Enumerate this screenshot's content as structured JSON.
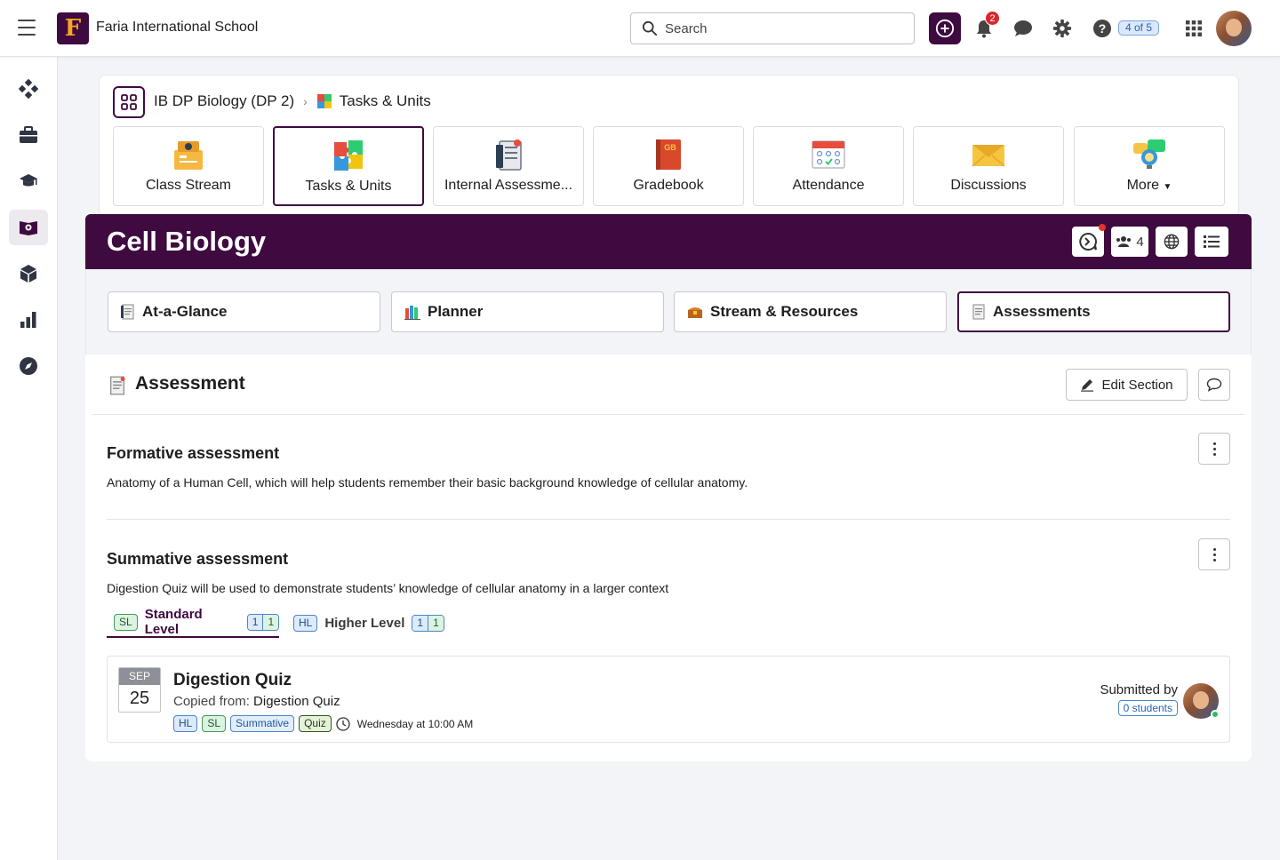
{
  "topbar": {
    "school_name": "Faria International School",
    "logo_letter": "F",
    "search_placeholder": "Search",
    "notification_count": "2",
    "help_progress": "4 of 5"
  },
  "breadcrumb": {
    "course": "IB DP Biology (DP 2)",
    "current": "Tasks & Units"
  },
  "tools": [
    {
      "label": "Class Stream",
      "icon": "class-stream-icon"
    },
    {
      "label": "Tasks & Units",
      "icon": "puzzle-icon"
    },
    {
      "label": "Internal Assessme...",
      "icon": "clipboard-icon"
    },
    {
      "label": "Gradebook",
      "icon": "gradebook-icon"
    },
    {
      "label": "Attendance",
      "icon": "calendar-icon"
    },
    {
      "label": "Discussions",
      "icon": "envelope-icon"
    },
    {
      "label": "More",
      "icon": "bulb-chat-icon"
    }
  ],
  "unit": {
    "title": "Cell Biology",
    "members_count": "4"
  },
  "section_tabs": [
    {
      "label": "At-a-Glance"
    },
    {
      "label": "Planner"
    },
    {
      "label": "Stream & Resources"
    },
    {
      "label": "Assessments"
    }
  ],
  "section": {
    "title": "Assessment",
    "edit_label": "Edit Section"
  },
  "assessments": [
    {
      "title": "Formative assessment",
      "description": "Anatomy of a Human Cell, which will help students remember their basic background knowledge of cellular anatomy."
    },
    {
      "title": "Summative assessment",
      "description": "Digestion Quiz will be used to demonstrate students’ knowledge of cellular anatomy in a larger context"
    }
  ],
  "levels": [
    {
      "tag": "SL",
      "label": "Standard Level",
      "count_a": "1",
      "count_b": "1"
    },
    {
      "tag": "HL",
      "label": "Higher Level",
      "count_a": "1",
      "count_b": "1"
    }
  ],
  "task": {
    "month": "SEP",
    "day": "25",
    "title": "Digestion Quiz",
    "copied_prefix": "Copied from:",
    "copied_from": "Digestion Quiz",
    "tags": [
      "HL",
      "SL",
      "Summative",
      "Quiz"
    ],
    "due": "Wednesday at 10:00 AM",
    "submitted_label": "Submitted by",
    "submitted_count": "0 students"
  },
  "colors": {
    "brand": "#3f0a3f",
    "accent_blue": "#2a63b0",
    "notification_red": "#d8262c",
    "online_green": "#2ebd59"
  }
}
